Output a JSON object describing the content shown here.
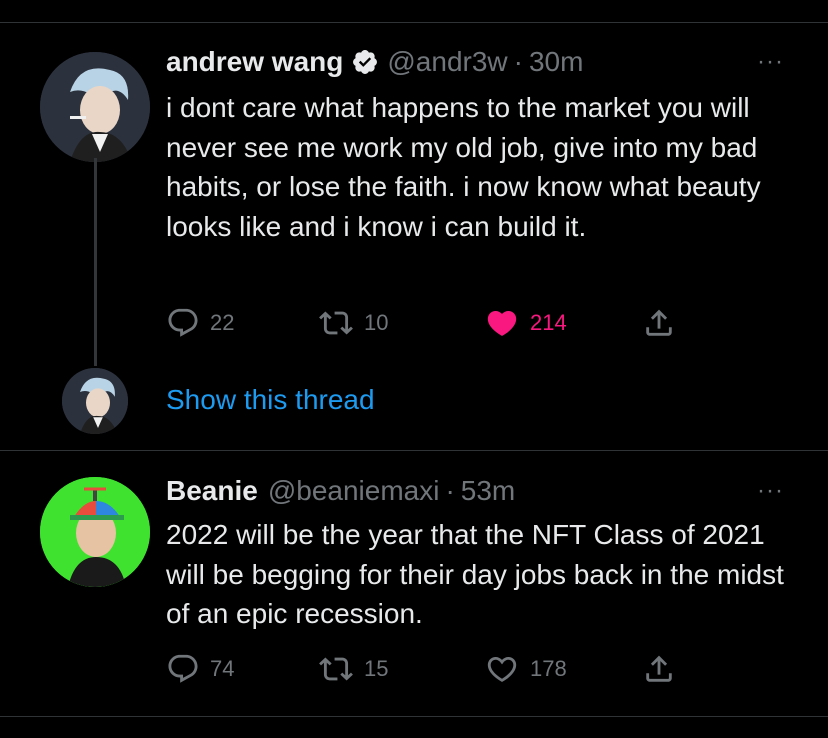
{
  "tweets": [
    {
      "name": "andrew wang",
      "verified": true,
      "handle": "@andr3w",
      "separator": "·",
      "time": "30m",
      "text": "i dont care what happens to the market you will never see me work my old job, give into my bad habits, or lose the faith. i now know what beauty looks like and i know i can build it.",
      "replies": "22",
      "retweets": "10",
      "likes": "214",
      "liked": true,
      "more_label": "···"
    },
    {
      "name": "Beanie",
      "verified": false,
      "handle": "@beaniemaxi",
      "separator": "·",
      "time": "53m",
      "text": "2022 will be the year that the NFT Class of 2021 will be begging for their day jobs back in the midst of an epic recession.",
      "replies": "74",
      "retweets": "15",
      "likes": "178",
      "liked": false,
      "more_label": "···"
    }
  ],
  "thread": {
    "show_label": "Show this thread"
  },
  "colors": {
    "like_active": "#f91880",
    "link": "#1d9bf0",
    "muted": "#71767b",
    "verified_badge": "#e7e9ea"
  },
  "icons": [
    "reply-icon",
    "retweet-icon",
    "like-icon",
    "share-icon",
    "verified-icon",
    "more-icon"
  ]
}
